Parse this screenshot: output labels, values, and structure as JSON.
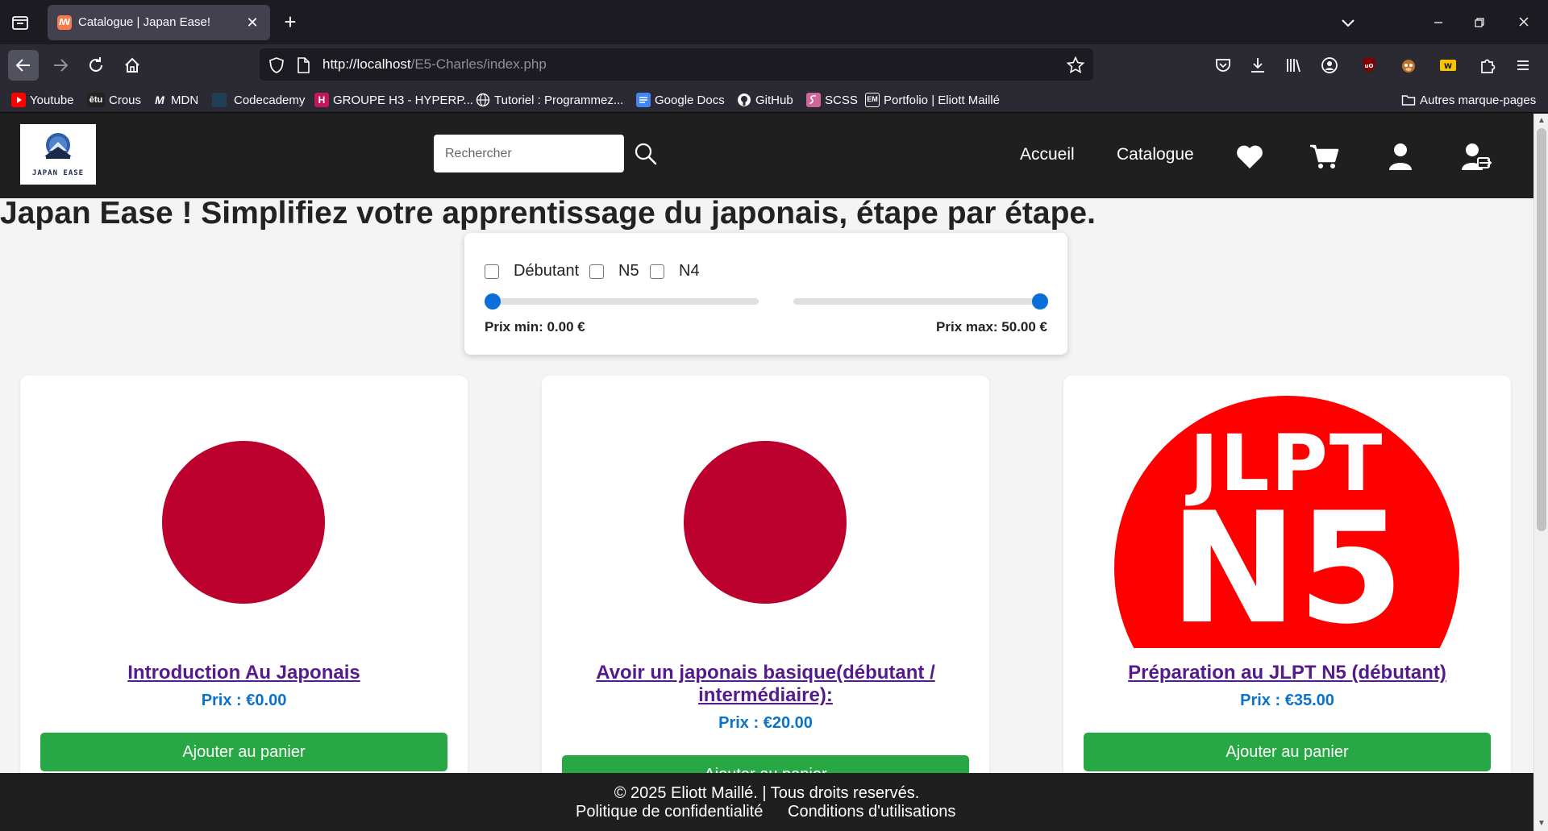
{
  "browser": {
    "tab_title": "Catalogue | Japan Ease!",
    "url_host": "http://localhost",
    "url_path": "/E5-Charles/index.php",
    "bookmarks": [
      {
        "label": "Youtube",
        "color": "#ff0000"
      },
      {
        "label": "Crous",
        "icon_text": "ētu",
        "color": "#222222"
      },
      {
        "label": "MDN",
        "icon_text": "M",
        "color": "#2b2a33"
      },
      {
        "label": "Codecademy",
        "color": "#1f4056"
      },
      {
        "label": "GROUPE H3 - HYPERP...",
        "icon_text": "H",
        "color": "#c2185b"
      },
      {
        "label": "Tutoriel : Programmez...",
        "color": "#2b2a33"
      },
      {
        "label": "Google Docs",
        "color": "#4285f4"
      },
      {
        "label": "GitHub",
        "color": "#2b2a33"
      },
      {
        "label": "SCSS",
        "color": "#cd6799"
      },
      {
        "label": "Portfolio | Eliott Maillé",
        "icon_text": "EM",
        "color": "#2b2a33"
      }
    ],
    "other_bookmarks": "Autres marque-pages"
  },
  "header": {
    "logo_text": "JAPAN EASE",
    "search_placeholder": "Rechercher",
    "nav": [
      "Accueil",
      "Catalogue"
    ],
    "icons": [
      "heart-icon",
      "cart-icon",
      "user-icon",
      "logout-icon"
    ]
  },
  "hero": "Japan Ease ! Simplifiez votre apprentissage du japonais, étape par étape.",
  "filters": {
    "levels": [
      "Débutant",
      "N5",
      "N4"
    ],
    "checked": [
      false,
      false,
      false
    ],
    "price_min_label": "Prix min: 0.00 €",
    "price_max_label": "Prix max: 50.00 €",
    "price_min_value": 0,
    "price_max_value": 50
  },
  "products": [
    {
      "title": "Introduction Au Japonais",
      "price": "Prix : €0.00",
      "image": "japan-flag",
      "button": "Ajouter au panier"
    },
    {
      "title": "Avoir un japonais basique(débutant / intermédiaire):",
      "price": "Prix : €20.00",
      "image": "japan-flag",
      "button": "Ajouter au panier"
    },
    {
      "title": "Préparation au JLPT N5 (débutant)",
      "price": "Prix : €35.00",
      "image": "jlpt-n5",
      "image_text": [
        "JLPT",
        "N5"
      ],
      "button": "Ajouter au panier"
    }
  ],
  "footer": {
    "copyright": "© 2025 Eliott Maillé. | Tous droits reservés.",
    "links": [
      "Politique de confidentialité",
      "Conditions d'utilisations"
    ]
  },
  "colors": {
    "header_bg": "#1f1f1f",
    "accent_green": "#28a745",
    "price_blue": "#0a72cc",
    "link_purple": "#551a8b",
    "flag_red": "#bc002d",
    "slider_blue": "#0a6fd8"
  }
}
